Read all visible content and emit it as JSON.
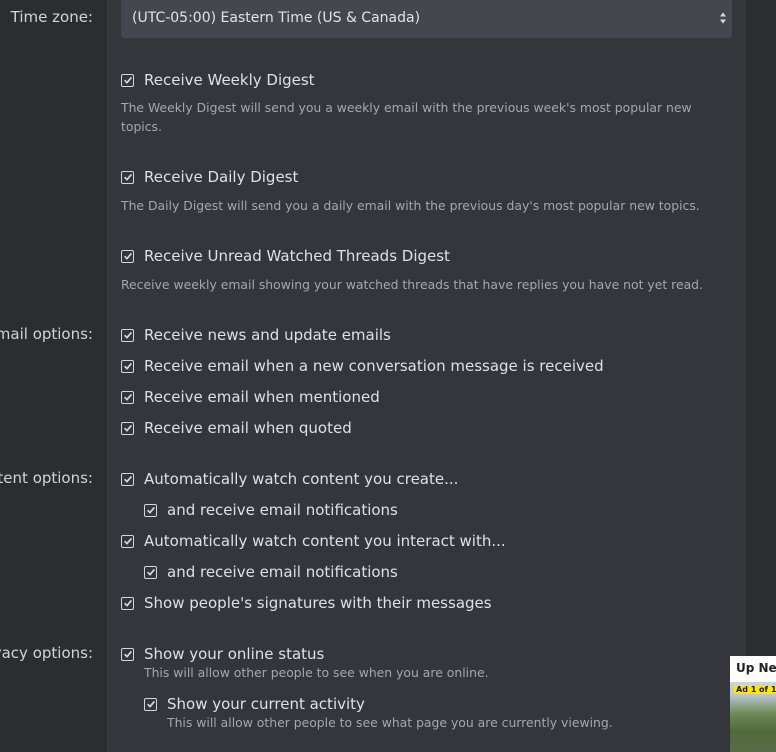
{
  "labels": {
    "timezone": "Time zone:",
    "email_options": "mail options:",
    "content_options": "tent options:",
    "privacy_options": "vacy options:"
  },
  "timezone": {
    "selected": "(UTC-05:00) Eastern Time (US & Canada)"
  },
  "digests": [
    {
      "label": "Receive Weekly Digest",
      "checked": true,
      "hint": "The Weekly Digest will send you a weekly email with the previous week's most popular new",
      "hint2": "topics."
    },
    {
      "label": "Receive Daily Digest",
      "checked": true,
      "hint": "The Daily Digest will send you a daily email with the previous day's most popular new topics."
    },
    {
      "label": "Receive Unread Watched Threads Digest",
      "checked": true,
      "hint": "Receive weekly email showing your watched threads that have replies you have not yet read."
    }
  ],
  "email_options": [
    {
      "label": "Receive news and update emails",
      "checked": true
    },
    {
      "label": "Receive email when a new conversation message is received",
      "checked": true
    },
    {
      "label": "Receive email when mentioned",
      "checked": true
    },
    {
      "label": "Receive email when quoted",
      "checked": true
    }
  ],
  "content_options": [
    {
      "label": "Automatically watch content you create...",
      "checked": true
    },
    {
      "label": "and receive email notifications",
      "checked": true
    },
    {
      "label": "Automatically watch content you interact with...",
      "checked": true
    },
    {
      "label": "and receive email notifications",
      "checked": true
    },
    {
      "label": "Show people's signatures with their messages",
      "checked": true
    }
  ],
  "privacy_options": [
    {
      "label": "Show your online status",
      "checked": true,
      "hint": "This will allow other people to see when you are online."
    },
    {
      "label": "Show your current activity",
      "checked": true,
      "hint": "This will allow other people to see what page you are currently viewing."
    }
  ],
  "upnext": {
    "title": "Up Nex",
    "ad_badge": "Ad 1 of 1"
  },
  "colors": {
    "panel": "#35363c",
    "background": "#2c2d31",
    "select": "#46474e",
    "text": "#dfe0e4",
    "hint": "#a6a7ad"
  }
}
